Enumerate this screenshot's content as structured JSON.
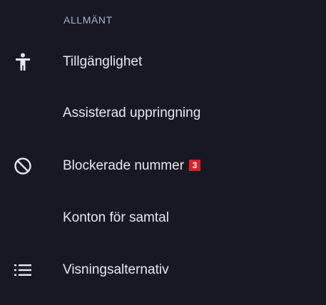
{
  "section": {
    "header": "ALLMÄNT"
  },
  "items": [
    {
      "label": "Tillgänglighet",
      "icon": "accessibility-icon"
    },
    {
      "label": "Assisterad uppringning",
      "icon": ""
    },
    {
      "label": "Blockerade nummer",
      "icon": "block-icon",
      "badge": "3"
    },
    {
      "label": "Konton för samtal",
      "icon": ""
    },
    {
      "label": "Visningsalternativ",
      "icon": "list-icon"
    }
  ],
  "colors": {
    "background": "#161924",
    "text": "#e6e8ef",
    "header_text": "#aeb4c4",
    "badge_bg": "#e01e26"
  }
}
